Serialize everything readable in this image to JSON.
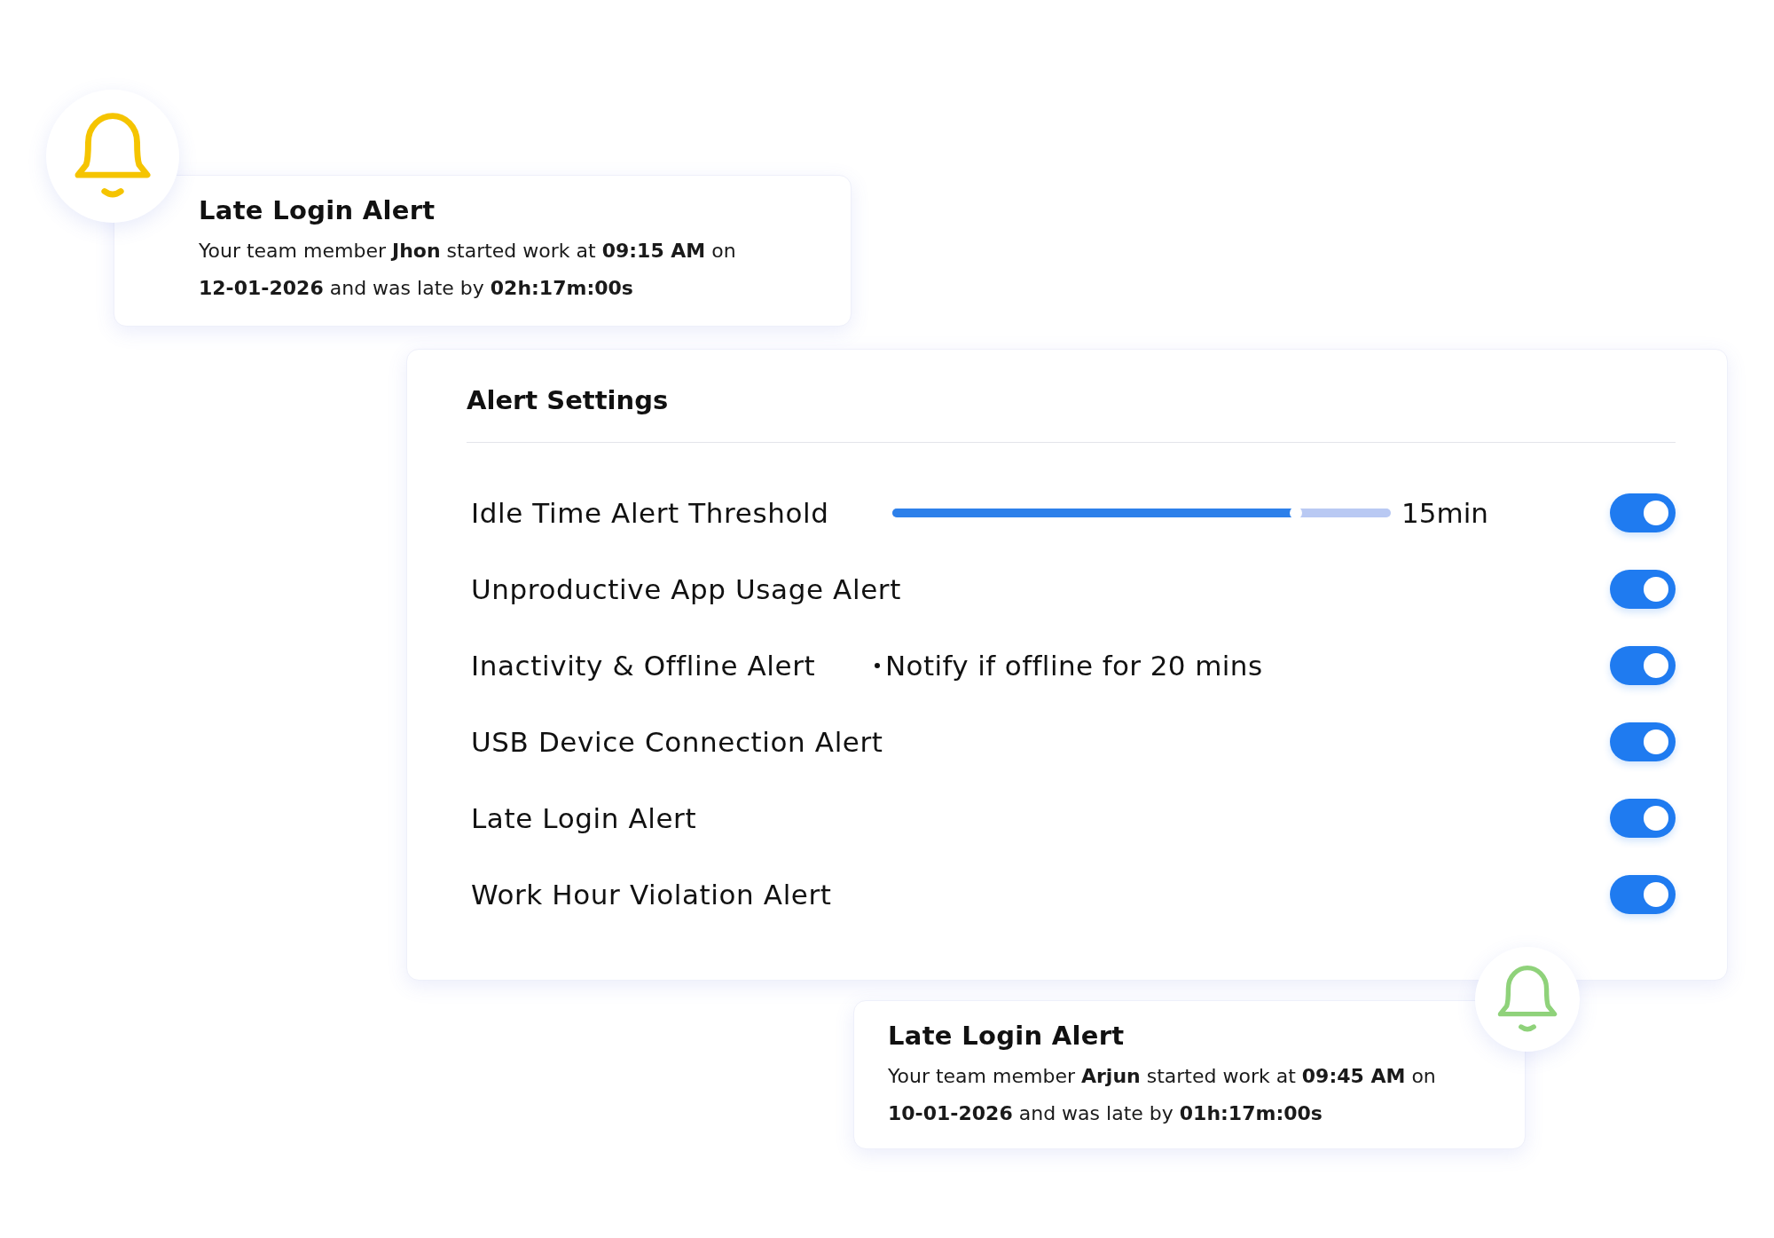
{
  "notifications": [
    {
      "title": "Late Login Alert",
      "message": "Your team member **Jhon** started work at **09:15 AM** on **12-01-2026** and was late by **02h:17m:00s**",
      "color": "#f5c400",
      "kind": "left_bell"
    },
    {
      "title": "Late Login Alert",
      "message": "Your team member **Arjun** started work at **09:45 AM** on **10-01-2026** and was late by **01h:17m:00s**",
      "color": "#8fd27a",
      "kind": "right_bell"
    }
  ],
  "alert_settings": {
    "title": "Alert Settings",
    "rows": [
      {
        "kind": "slider",
        "label": "Idle Time Alert Threshold",
        "level": 0.81,
        "reading": "15min",
        "on": true
      },
      {
        "kind": "plain",
        "label": "Unproductive App Usage Alert",
        "on": true
      },
      {
        "kind": "note",
        "label": "Inactivity & Offline Alert",
        "note": "Notify if offline for 20 mins",
        "on": true
      },
      {
        "kind": "plain",
        "label": "USB Device Connection Alert",
        "on": true
      },
      {
        "kind": "plain",
        "label": "Late Login Alert",
        "on": true
      },
      {
        "kind": "plain",
        "label": "Work Hour Violation Alert",
        "on": true
      }
    ]
  }
}
